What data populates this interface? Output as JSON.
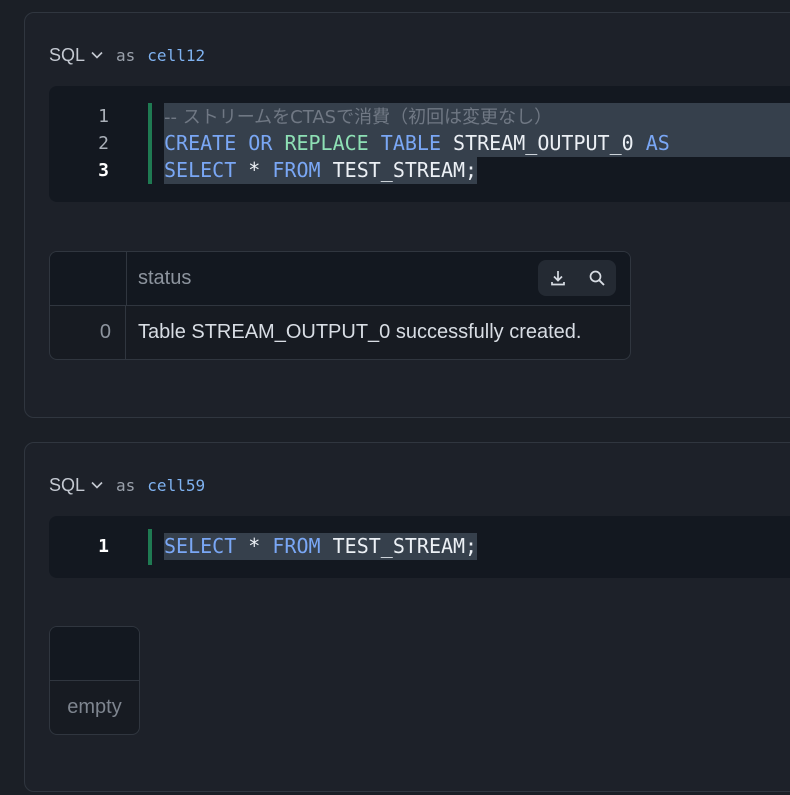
{
  "cells": [
    {
      "language": "SQL",
      "as_label": "as",
      "name": "cell12",
      "line_numbers": [
        "1",
        "2",
        "3"
      ],
      "code": {
        "line1_comment": "-- ストリームをCTASで消費（初回は変更なし）",
        "line2": {
          "kw1": "CREATE",
          "kw2": "OR",
          "kw3": "REPLACE",
          "kw4": "TABLE",
          "ident": "STREAM_OUTPUT_0",
          "kw5": "AS"
        },
        "line3": {
          "kw1": "SELECT",
          "star": "*",
          "kw2": "FROM",
          "ident": "TEST_STREAM;"
        }
      },
      "result": {
        "column": "status",
        "rows": [
          {
            "index": "0",
            "status": "Table STREAM_OUTPUT_0 successfully created."
          }
        ]
      }
    },
    {
      "language": "SQL",
      "as_label": "as",
      "name": "cell59",
      "line_numbers": [
        "1"
      ],
      "code": {
        "line1": {
          "kw1": "SELECT",
          "star": "*",
          "kw2": "FROM",
          "ident": "TEST_STREAM;"
        }
      },
      "result": {
        "empty_text": "empty"
      }
    }
  ],
  "icons": {
    "language_dropdown": "chevron-down-icon",
    "download": "download-icon",
    "search": "search-icon"
  },
  "colors": {
    "keyword": "#7aa7f5",
    "keyword_alt": "#8ee0b5",
    "cell_name": "#7fb2f0",
    "active_line_marker": "#1f7a52"
  }
}
